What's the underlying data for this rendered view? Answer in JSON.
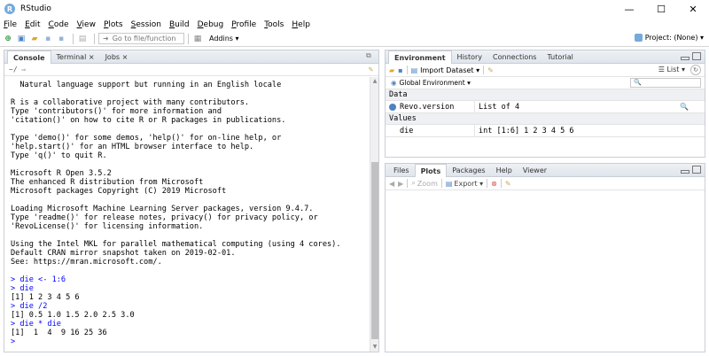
{
  "window": {
    "title": "RStudio",
    "app_icon_letter": "R",
    "controls": {
      "minimize": "—",
      "maximize": "☐",
      "close": "✕"
    }
  },
  "menu": [
    {
      "pre": "",
      "u": "F",
      "post": "ile"
    },
    {
      "pre": "",
      "u": "E",
      "post": "dit"
    },
    {
      "pre": "",
      "u": "C",
      "post": "ode"
    },
    {
      "pre": "",
      "u": "V",
      "post": "iew"
    },
    {
      "pre": "",
      "u": "P",
      "post": "lots"
    },
    {
      "pre": "",
      "u": "S",
      "post": "ession"
    },
    {
      "pre": "",
      "u": "B",
      "post": "uild"
    },
    {
      "pre": "",
      "u": "D",
      "post": "ebug"
    },
    {
      "pre": "",
      "u": "P",
      "post": "rofile"
    },
    {
      "pre": "",
      "u": "T",
      "post": "ools"
    },
    {
      "pre": "",
      "u": "H",
      "post": "elp"
    }
  ],
  "toolbar": {
    "goto_placeholder": "Go to file/function",
    "addins_label": "Addins ▾",
    "project_label": "Project: (None) ▾"
  },
  "console_pane": {
    "tabs": [
      {
        "label": "Console",
        "active": true
      },
      {
        "label": "Terminal ×",
        "active": false
      },
      {
        "label": "Jobs ×",
        "active": false
      }
    ],
    "path": "~/ ⇨",
    "output": [
      {
        "text": "  Natural language support but running in an English locale",
        "type": "out"
      },
      {
        "text": "",
        "type": "out"
      },
      {
        "text": "R is a collaborative project with many contributors.",
        "type": "out"
      },
      {
        "text": "Type 'contributors()' for more information and",
        "type": "out"
      },
      {
        "text": "'citation()' on how to cite R or R packages in publications.",
        "type": "out"
      },
      {
        "text": "",
        "type": "out"
      },
      {
        "text": "Type 'demo()' for some demos, 'help()' for on-line help, or",
        "type": "out"
      },
      {
        "text": "'help.start()' for an HTML browser interface to help.",
        "type": "out"
      },
      {
        "text": "Type 'q()' to quit R.",
        "type": "out"
      },
      {
        "text": "",
        "type": "out"
      },
      {
        "text": "Microsoft R Open 3.5.2",
        "type": "out"
      },
      {
        "text": "The enhanced R distribution from Microsoft",
        "type": "out"
      },
      {
        "text": "Microsoft packages Copyright (C) 2019 Microsoft",
        "type": "out"
      },
      {
        "text": "",
        "type": "out"
      },
      {
        "text": "Loading Microsoft Machine Learning Server packages, version 9.4.7.",
        "type": "out"
      },
      {
        "text": "Type 'readme()' for release notes, privacy() for privacy policy, or",
        "type": "out"
      },
      {
        "text": "'RevoLicense()' for licensing information.",
        "type": "out"
      },
      {
        "text": "",
        "type": "out"
      },
      {
        "text": "Using the Intel MKL for parallel mathematical computing (using 4 cores).",
        "type": "out"
      },
      {
        "text": "Default CRAN mirror snapshot taken on 2019-02-01.",
        "type": "out"
      },
      {
        "text": "See: https://mran.microsoft.com/.",
        "type": "out"
      },
      {
        "text": "",
        "type": "out"
      },
      {
        "text": "> die <- 1:6",
        "type": "in"
      },
      {
        "text": "> die",
        "type": "in"
      },
      {
        "text": "[1] 1 2 3 4 5 6",
        "type": "out"
      },
      {
        "text": "> die /2",
        "type": "in"
      },
      {
        "text": "[1] 0.5 1.0 1.5 2.0 2.5 3.0",
        "type": "out"
      },
      {
        "text": "> die * die",
        "type": "in"
      },
      {
        "text": "[1]  1  4  9 16 25 36",
        "type": "out"
      },
      {
        "text": ">",
        "type": "in"
      }
    ]
  },
  "env_pane": {
    "tabs": [
      {
        "label": "Environment",
        "active": true
      },
      {
        "label": "History",
        "active": false
      },
      {
        "label": "Connections",
        "active": false
      },
      {
        "label": "Tutorial",
        "active": false
      }
    ],
    "import_label": "Import Dataset ▾",
    "list_label": "☰ List ▾",
    "env_selector": "Global Environment ▾",
    "search_placeholder": "🔍",
    "data_header": "Data",
    "data_rows": [
      {
        "name": "Revo.version",
        "value": "List of 4"
      }
    ],
    "values_header": "Values",
    "value_rows": [
      {
        "name": "die",
        "value": "int [1:6] 1 2 3 4 5 6"
      }
    ]
  },
  "files_pane": {
    "tabs": [
      {
        "label": "Files",
        "active": false
      },
      {
        "label": "Plots",
        "active": true
      },
      {
        "label": "Packages",
        "active": false
      },
      {
        "label": "Help",
        "active": false
      },
      {
        "label": "Viewer",
        "active": false
      }
    ],
    "zoom_label": "Zoom",
    "export_label": "Export ▾"
  },
  "colors": {
    "accent": "#75aadb",
    "prompt": "#0000ff",
    "pane_border": "#c9ced6"
  }
}
